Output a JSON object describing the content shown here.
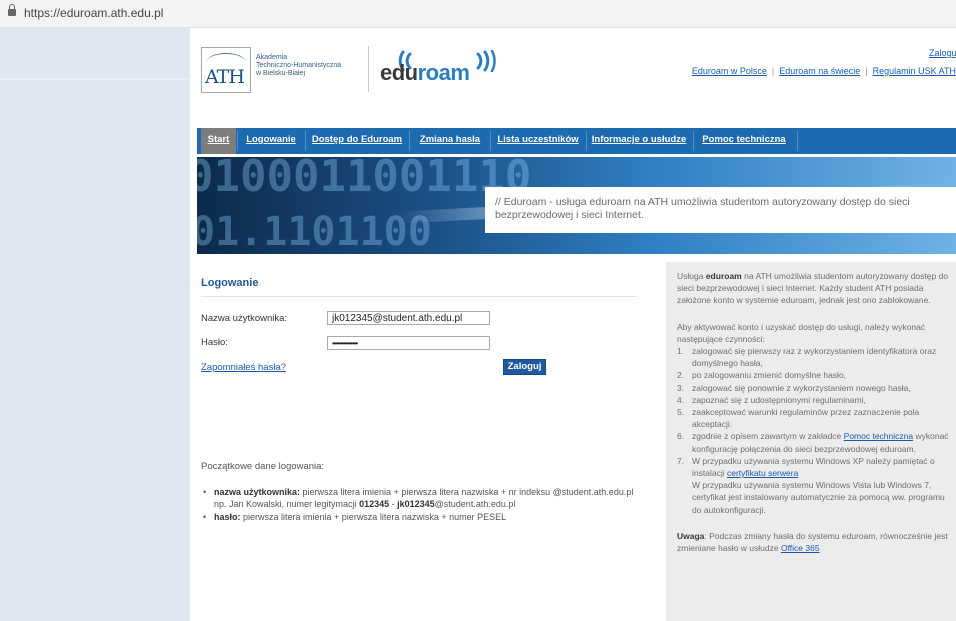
{
  "browser": {
    "url": "https://eduroam.ath.edu.pl"
  },
  "header": {
    "ath_logo_letters": "ATH",
    "ath_name_lines": [
      "Akademia",
      "Techniczno-Humanistyczna",
      "w Bielsku-Białej"
    ],
    "eduroam_logo": {
      "part1": "edu",
      "part2": "roam"
    },
    "zaloguj_link": "Zaloguj",
    "links": [
      "Eduroam w Polsce",
      "Eduroam na świecie",
      "Regulamin USK ATH"
    ]
  },
  "nav": {
    "items": [
      "Start",
      "Logowanie",
      "Dostęp do Eduroam",
      "Zmiana hasła",
      "Lista uczestników",
      "Informacje o usłudze",
      "Pomoc techniczna"
    ],
    "active": "Start"
  },
  "banner": {
    "digits_top": "0100011001110",
    "digits_bottom": "01.1101100",
    "text": "// Eduroam - usługa eduroam na ATH umożliwia studentom autoryzowany dostęp do sieci bezprzewodowej i sieci Internet."
  },
  "login": {
    "title": "Logowanie",
    "username_label": "Nazwa użytkownika:",
    "username_value": "jk012345@student.ath.edu.pl",
    "password_label": "Hasło:",
    "password_value": "••••••••••••••",
    "forgot_link": "Zapomniałeś hasła?",
    "submit": "Zaloguj"
  },
  "initial_data": {
    "title": "Początkowe dane logowania:",
    "items": [
      {
        "label": "nazwa użytkownika:",
        "text": " pierwsza litera imienia + pierwsza litera nazwiska + nr indeksu @student.ath.edu.pl np. Jan Kowalski, numer legitymacji ",
        "b1": "012345",
        "mid": " - ",
        "b2": "jk012345",
        "tail": "@student.ath.edu.pl"
      },
      {
        "label": "hasło:",
        "text": " pierwsza litera imienia + pierwsza litera nazwiska + numer PESEL"
      }
    ]
  },
  "info_panel": {
    "intro_pre": "Usługa ",
    "intro_bold": "eduroam",
    "intro_post": " na ATH umożliwia studentom autoryzowany dostęp do sieci bezprzewodowej i sieci Internet. Każdy student ATH posiada założone konto w systemie eduroam, jednak jest ono zablokowane.",
    "steps_intro": "Aby aktywować konto i uzyskać dostęp do usługi, należy wykonać następujące czynności:",
    "steps": [
      "zalogować się pierwszy raz z wykorzystaniem identyfikatora oraz domyślnego hasła,",
      "po zalogowaniu zmienić domyślne hasło,",
      "zalogować się ponownie z wykorzystaniem nowego hasła,",
      "zapoznać się z udostępnionymi regulaminami,",
      "zaakceptować warunki regulaminów przez zaznaczenie pola akceptacji."
    ],
    "step6_pre": "zgodnie z opisem zawartym w zakładce ",
    "step6_link": "Pomoc techniczna",
    "step6_post": " wykonać konfigurację połączenia do sieci bezprzewodowej eduroam.",
    "step7_pre": "W przypadku używania systemu Windows XP należy pamiętać o instalacji ",
    "step7_link": "certyfikatu serwera",
    "step7_post": "W przypadku używania systemu Windows Vista lub Windows 7, certyfikat jest instalowany automatycznie za pomocą ww. programu do autokonfiguracji.",
    "warning_label": "Uwaga",
    "warning_text": ": Podczas zmiany hasła do systemu eduroam, równocześnie jest zmieniane hasło w usłudze ",
    "warning_link": "Office 365"
  }
}
